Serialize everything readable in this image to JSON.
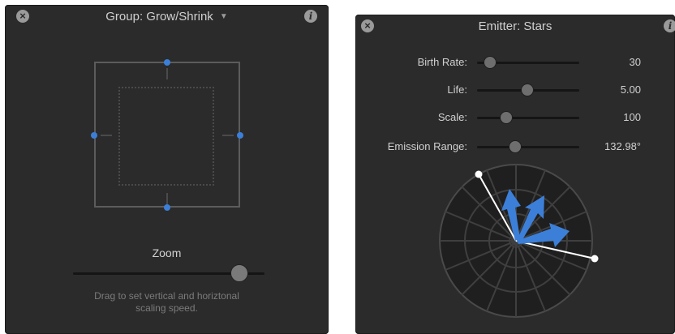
{
  "group_panel": {
    "title": "Group: Grow/Shrink",
    "close_icon": "close-icon",
    "dropdown_icon": "chevron-down-icon",
    "info_icon": "info-icon",
    "zoom_label": "Zoom",
    "zoom_value": 0.88,
    "help_line1": "Drag to set vertical and horiztonal",
    "help_line2": "scaling speed."
  },
  "emitter_panel": {
    "title": "Emitter: Stars",
    "close_icon": "close-icon",
    "info_icon": "info-icon",
    "params": [
      {
        "label": "Birth Rate:",
        "value": "30",
        "slider": 0.12
      },
      {
        "label": "Life:",
        "value": "5.00",
        "slider": 0.48
      },
      {
        "label": "Scale:",
        "value": "100",
        "slider": 0.25
      },
      {
        "label": "Emission Range:",
        "value": "132.98°",
        "slider": 0.32
      }
    ]
  },
  "colors": {
    "panel_bg": "#2b2b2b",
    "accent_blue": "#3c7fd8",
    "text": "#d0d0d0",
    "muted_text": "#7b7b7b"
  }
}
